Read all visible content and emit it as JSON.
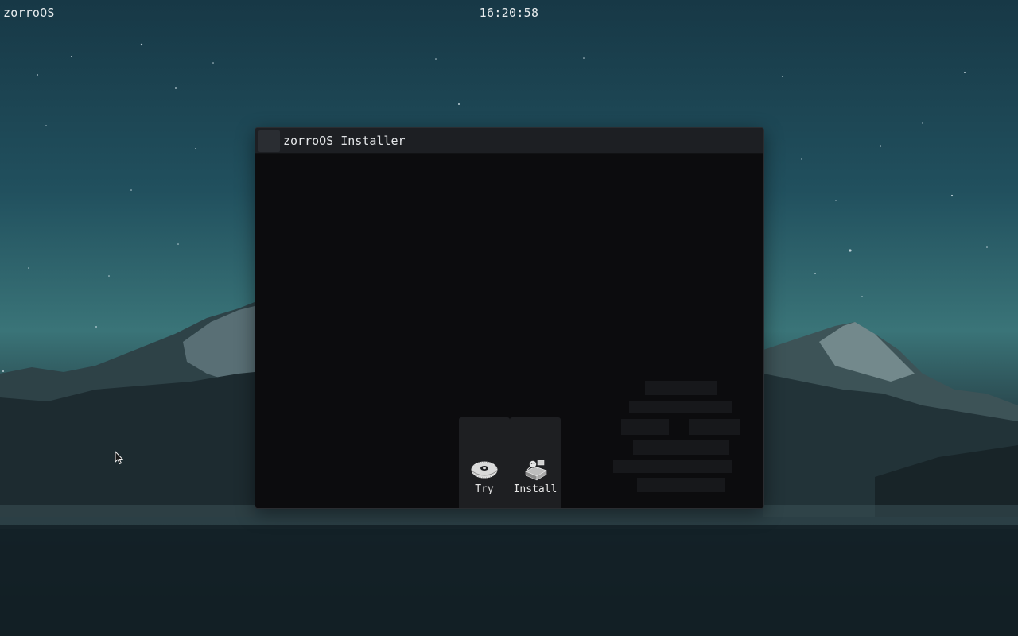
{
  "topbar": {
    "os_name": "zorroOS",
    "clock": "16:20:58"
  },
  "window": {
    "title": "zorroOS Installer",
    "options": [
      {
        "label": "Try",
        "icon": "disc-icon"
      },
      {
        "label": "Install",
        "icon": "installer-icon"
      }
    ]
  },
  "colors": {
    "window_bg": "#0c0c0e",
    "titlebar_bg": "#1d1f23",
    "option_bg": "#1e1f22",
    "text": "#e6e6e6"
  }
}
